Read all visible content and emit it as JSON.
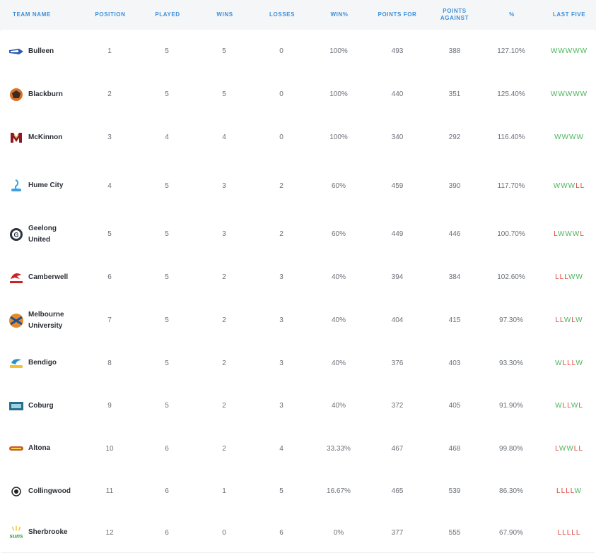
{
  "columns": {
    "team": "TEAM NAME",
    "position": "POSITION",
    "played": "PLAYED",
    "wins": "WINS",
    "losses": "LOSSES",
    "win_pct": "WIN%",
    "points_for": "POINTS FOR",
    "points_against": "POINTS AGAINST",
    "percentage": "%",
    "last_five": "LAST FIVE"
  },
  "rows": [
    {
      "team": "Bulleen",
      "position": "1",
      "played": "5",
      "wins": "5",
      "losses": "0",
      "win_pct": "100%",
      "points_for": "493",
      "points_against": "388",
      "percentage": "127.10%",
      "last_five": "WWWWW",
      "logo": "bulleen-logo",
      "logo_color": "#2a5bb5"
    },
    {
      "team": "Blackburn",
      "position": "2",
      "played": "5",
      "wins": "5",
      "losses": "0",
      "win_pct": "100%",
      "points_for": "440",
      "points_against": "351",
      "percentage": "125.40%",
      "last_five": "WWWWW",
      "logo": "blackburn-logo",
      "logo_color": "#d8712a"
    },
    {
      "team": "McKinnon",
      "position": "3",
      "played": "4",
      "wins": "4",
      "losses": "0",
      "win_pct": "100%",
      "points_for": "340",
      "points_against": "292",
      "percentage": "116.40%",
      "last_five": "WWWW",
      "logo": "mckinnon-logo",
      "logo_color": "#8a1a22"
    },
    {
      "team": "Hume City",
      "position": "4",
      "played": "5",
      "wins": "3",
      "losses": "2",
      "win_pct": "60%",
      "points_for": "459",
      "points_against": "390",
      "percentage": "117.70%",
      "last_five": "WWWLL",
      "logo": "hume-city-logo",
      "logo_color": "#3fa0e0"
    },
    {
      "team": "Geelong United",
      "position": "5",
      "played": "5",
      "wins": "3",
      "losses": "2",
      "win_pct": "60%",
      "points_for": "449",
      "points_against": "446",
      "percentage": "100.70%",
      "last_five": "LWWWL",
      "logo": "geelong-united-logo",
      "logo_color": "#2a3340"
    },
    {
      "team": "Camberwell",
      "position": "6",
      "played": "5",
      "wins": "2",
      "losses": "3",
      "win_pct": "40%",
      "points_for": "394",
      "points_against": "384",
      "percentage": "102.60%",
      "last_five": "LLLWW",
      "logo": "camberwell-logo",
      "logo_color": "#c8232b"
    },
    {
      "team": "Melbourne University",
      "position": "7",
      "played": "5",
      "wins": "2",
      "losses": "3",
      "win_pct": "40%",
      "points_for": "404",
      "points_against": "415",
      "percentage": "97.30%",
      "last_five": "LLWLW",
      "logo": "melbourne-university-logo",
      "logo_color": "#1d4f9a"
    },
    {
      "team": "Bendigo",
      "position": "8",
      "played": "5",
      "wins": "2",
      "losses": "3",
      "win_pct": "40%",
      "points_for": "376",
      "points_against": "403",
      "percentage": "93.30%",
      "last_five": "WLLLW",
      "logo": "bendigo-logo",
      "logo_color": "#2b8fc9"
    },
    {
      "team": "Coburg",
      "position": "9",
      "played": "5",
      "wins": "2",
      "losses": "3",
      "win_pct": "40%",
      "points_for": "372",
      "points_against": "405",
      "percentage": "91.90%",
      "last_five": "WLLWL",
      "logo": "coburg-logo",
      "logo_color": "#2a6f8a"
    },
    {
      "team": "Altona",
      "position": "10",
      "played": "6",
      "wins": "2",
      "losses": "4",
      "win_pct": "33.33%",
      "points_for": "467",
      "points_against": "468",
      "percentage": "99.80%",
      "last_five": "LWWLL",
      "logo": "altona-logo",
      "logo_color": "#c95a2a"
    },
    {
      "team": "Collingwood",
      "position": "11",
      "played": "6",
      "wins": "1",
      "losses": "5",
      "win_pct": "16.67%",
      "points_for": "465",
      "points_against": "539",
      "percentage": "86.30%",
      "last_five": "LLLLW",
      "logo": "collingwood-logo",
      "logo_color": "#222222"
    },
    {
      "team": "Sherbrooke",
      "position": "12",
      "played": "6",
      "wins": "0",
      "losses": "6",
      "win_pct": "0%",
      "points_for": "377",
      "points_against": "555",
      "percentage": "67.90%",
      "last_five": "LLLLL",
      "logo": "sherbrooke-logo",
      "logo_color": "#2f9a3a"
    }
  ],
  "colors": {
    "header_text": "#3d8fd9",
    "win": "#4cb45c",
    "loss": "#e0453c"
  }
}
